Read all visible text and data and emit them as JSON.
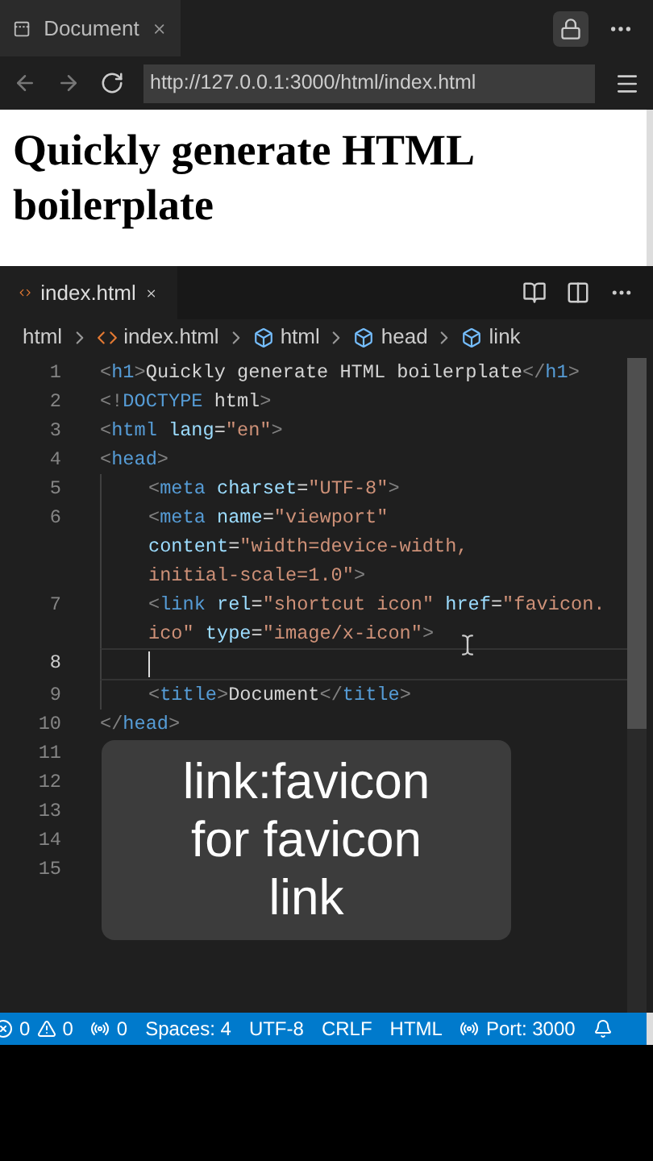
{
  "browser": {
    "tab_title": "Document",
    "url": "http://127.0.0.1:3000/html/index.html"
  },
  "page": {
    "heading": "Quickly generate HTML boilerplate"
  },
  "editor": {
    "tab": {
      "label": "index.html",
      "selected": true
    },
    "breadcrumbs": [
      {
        "kind": "folder",
        "label": "html"
      },
      {
        "kind": "file",
        "label": "index.html"
      },
      {
        "kind": "symbol",
        "label": "html"
      },
      {
        "kind": "symbol",
        "label": "head"
      },
      {
        "kind": "symbol",
        "label": "link"
      }
    ],
    "lines": [
      {
        "number": "1",
        "current": false,
        "visual_lines": [
          {
            "tokens": [
              {
                "kind": "punct",
                "text": "<"
              },
              {
                "kind": "tag",
                "text": "h1"
              },
              {
                "kind": "punct",
                "text": ">"
              },
              {
                "kind": "text",
                "text": "Quickly generate HTML boilerplate"
              },
              {
                "kind": "punct",
                "text": "</"
              },
              {
                "kind": "tag",
                "text": "h1"
              },
              {
                "kind": "punct",
                "text": ">"
              }
            ]
          }
        ]
      },
      {
        "number": "2",
        "current": false,
        "visual_lines": [
          {
            "tokens": [
              {
                "kind": "punct",
                "text": "<!"
              },
              {
                "kind": "tag",
                "text": "DOCTYPE"
              },
              {
                "kind": "text",
                "text": " html"
              },
              {
                "kind": "punct",
                "text": ">"
              }
            ]
          }
        ]
      },
      {
        "number": "3",
        "current": false,
        "visual_lines": [
          {
            "tokens": [
              {
                "kind": "punct",
                "text": "<"
              },
              {
                "kind": "tag",
                "text": "html"
              },
              {
                "kind": "attr",
                "text": " lang"
              },
              {
                "kind": "text",
                "text": "="
              },
              {
                "kind": "string",
                "text": "\"en\""
              },
              {
                "kind": "punct",
                "text": ">"
              }
            ]
          }
        ]
      },
      {
        "number": "4",
        "current": false,
        "visual_lines": [
          {
            "tokens": [
              {
                "kind": "punct",
                "text": "<"
              },
              {
                "kind": "tag",
                "text": "head"
              },
              {
                "kind": "punct",
                "text": ">"
              }
            ]
          }
        ]
      },
      {
        "number": "5",
        "current": false,
        "indent": true,
        "visual_lines": [
          {
            "tokens": [
              {
                "kind": "punct",
                "text": "<"
              },
              {
                "kind": "tag",
                "text": "meta"
              },
              {
                "kind": "attr",
                "text": " charset"
              },
              {
                "kind": "text",
                "text": "="
              },
              {
                "kind": "string",
                "text": "\"UTF-8\""
              },
              {
                "kind": "punct",
                "text": ">"
              }
            ]
          }
        ]
      },
      {
        "number": "6",
        "current": false,
        "indent": true,
        "visual_lines": [
          {
            "tokens": [
              {
                "kind": "punct",
                "text": "<"
              },
              {
                "kind": "tag",
                "text": "meta"
              },
              {
                "kind": "attr",
                "text": " name"
              },
              {
                "kind": "text",
                "text": "="
              },
              {
                "kind": "string",
                "text": "\"viewport\""
              }
            ]
          },
          {
            "tokens": [
              {
                "kind": "attr",
                "text": "content"
              },
              {
                "kind": "text",
                "text": "="
              },
              {
                "kind": "string",
                "text": "\"width=device-width,"
              }
            ]
          },
          {
            "tokens": [
              {
                "kind": "string",
                "text": "initial-scale=1.0\""
              },
              {
                "kind": "punct",
                "text": ">"
              }
            ]
          }
        ]
      },
      {
        "number": "7",
        "current": false,
        "indent": true,
        "visual_lines": [
          {
            "tokens": [
              {
                "kind": "punct",
                "text": "<"
              },
              {
                "kind": "tag",
                "text": "link"
              },
              {
                "kind": "attr",
                "text": " rel"
              },
              {
                "kind": "text",
                "text": "="
              },
              {
                "kind": "string",
                "text": "\"shortcut icon\""
              },
              {
                "kind": "attr",
                "text": " href"
              },
              {
                "kind": "text",
                "text": "="
              },
              {
                "kind": "string",
                "text": "\"favicon."
              }
            ]
          },
          {
            "tokens": [
              {
                "kind": "string",
                "text": "ico\""
              },
              {
                "kind": "attr",
                "text": " type"
              },
              {
                "kind": "text",
                "text": "="
              },
              {
                "kind": "string",
                "text": "\"image/x-icon\""
              },
              {
                "kind": "punct",
                "text": ">"
              }
            ]
          }
        ]
      },
      {
        "number": "8",
        "current": true,
        "indent": true
      },
      {
        "number": "9",
        "current": false,
        "indent": true,
        "visual_lines": [
          {
            "tokens": [
              {
                "kind": "punct",
                "text": "<"
              },
              {
                "kind": "tag",
                "text": "title"
              },
              {
                "kind": "punct",
                "text": ">"
              },
              {
                "kind": "text",
                "text": "Document"
              },
              {
                "kind": "punct",
                "text": "</"
              },
              {
                "kind": "tag",
                "text": "title"
              },
              {
                "kind": "punct",
                "text": ">"
              }
            ]
          }
        ]
      },
      {
        "number": "10",
        "current": false,
        "visual_lines": [
          {
            "tokens": [
              {
                "kind": "punct",
                "text": "</"
              },
              {
                "kind": "tag",
                "text": "head"
              },
              {
                "kind": "punct",
                "text": ">"
              }
            ]
          }
        ]
      },
      {
        "number": "11",
        "current": false
      },
      {
        "number": "12",
        "current": false
      },
      {
        "number": "13",
        "current": false
      },
      {
        "number": "14",
        "current": false
      },
      {
        "number": "15",
        "current": false
      }
    ]
  },
  "caption": "link:favicon for favicon link",
  "status_bar": {
    "errors": "0",
    "warnings": "0",
    "ports": "0",
    "items": [
      "Spaces: 4",
      "UTF-8",
      "CRLF",
      "HTML"
    ],
    "port": "Port: 3000"
  }
}
